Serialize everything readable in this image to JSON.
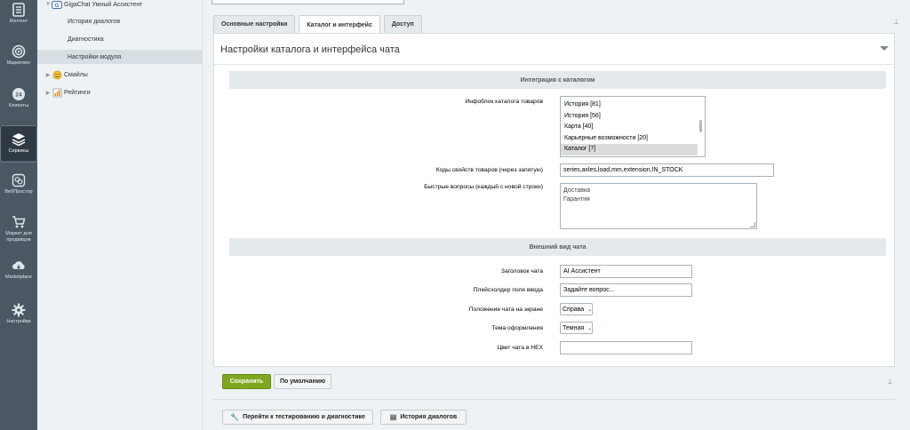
{
  "iconbar": {
    "items": [
      {
        "label": "Контент",
        "icon": "document-icon"
      },
      {
        "label": "Маркетинг",
        "icon": "target-icon"
      },
      {
        "label": "Клиенты",
        "icon": "clients-24-icon"
      },
      {
        "label": "Сервисы",
        "icon": "layers-icon"
      },
      {
        "label": "ВебПростор",
        "icon": "webprostor-icon"
      },
      {
        "label": "Маркет для продавцов",
        "icon": "cart-icon"
      },
      {
        "label": "Marketplace",
        "icon": "cloud-download-icon"
      },
      {
        "label": "Настройки",
        "icon": "gear-icon"
      }
    ],
    "active": "Сервисы"
  },
  "tree": {
    "root": "GigaChat Умный Ассистент",
    "children": [
      "История диалогов",
      "Диагностика",
      "Настройки модуля"
    ],
    "selected": "Настройки модуля",
    "siblings": [
      "Смайлы",
      "Рейтинги"
    ]
  },
  "tabs": [
    {
      "label": "Основные настройки",
      "active": false
    },
    {
      "label": "Каталог и интерфейс",
      "active": true
    },
    {
      "label": "Доступ",
      "active": false
    }
  ],
  "panel": {
    "title": "Настройки каталога и интерфейса чата",
    "section_catalog": "Интеграция с каталогом",
    "section_appearance": "Внешний вид чата"
  },
  "fields": {
    "infoblock_label": "Инфоблок каталога товаров",
    "infoblock_options": [
      "История [81]",
      "История [56]",
      "Карта [40]",
      "Карьерные возможности [20]",
      "Каталог [7]"
    ],
    "infoblock_selected": "Каталог [7]",
    "property_codes_label": "Коды свойств товаров (через запятую)",
    "property_codes_value": "series,axles,load,mm,extension,IN_STOCK",
    "quick_questions_label": "Быстрые вопросы (каждый с новой строки)",
    "quick_questions_value": "Доставка\nГарантия",
    "chat_title_label": "Заголовок чата",
    "chat_title_value": "AI Ассистент",
    "placeholder_label": "Плейсхолдер поля ввода",
    "placeholder_value": "Задайте вопрос...",
    "position_label": "Положение чата на экране",
    "position_value": "Справа",
    "theme_label": "Тема оформления",
    "theme_value": "Темная",
    "color_label": "Цвет чата в HEX",
    "color_value": ""
  },
  "buttons": {
    "save": "Сохранить",
    "default": "По умолчанию",
    "test": "Перейти к тестированию и диагностике",
    "history": "История диалогов"
  },
  "colors": {
    "save_green": "#7fa720",
    "sidebar_dark": "#4b5864"
  }
}
